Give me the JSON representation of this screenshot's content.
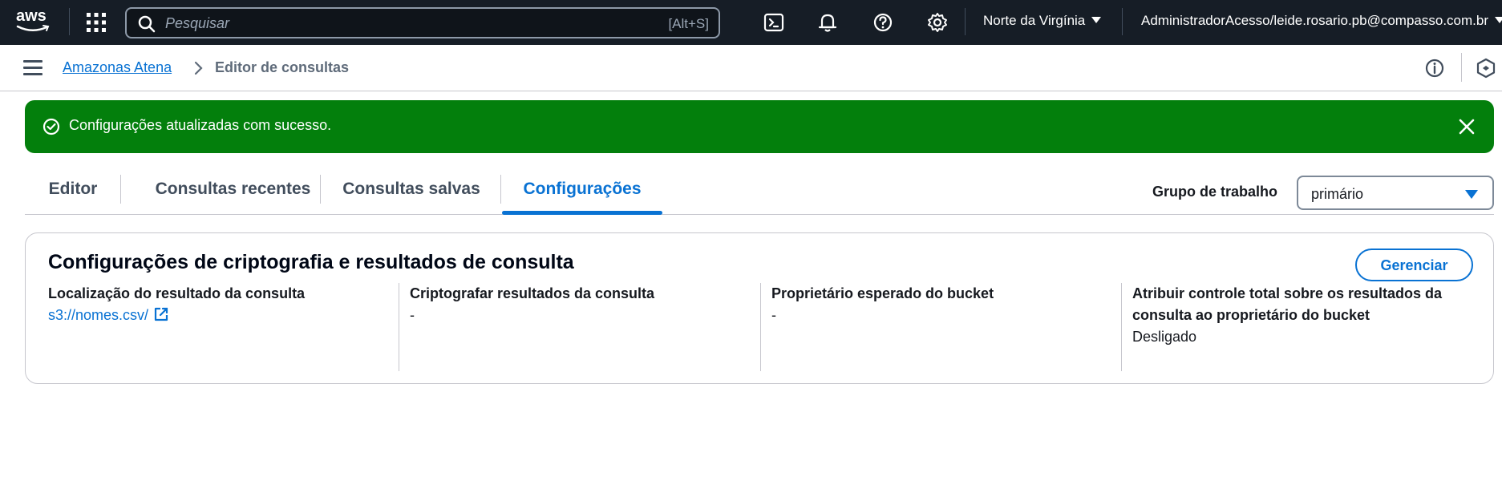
{
  "topnav": {
    "logo_text": "aws",
    "search_placeholder": "Pesquisar",
    "search_shortcut": "[Alt+S]",
    "region": "Norte da Virgínia",
    "account": "AdministradorAcesso/leide.rosario.pb@compasso.com.br",
    "icons": [
      "apps-grid-icon",
      "cloudshell-icon",
      "bell-icon",
      "help-icon",
      "gear-icon"
    ]
  },
  "breadcrumb": {
    "items": [
      "Amazonas Atena",
      "Editor de consultas"
    ]
  },
  "flash": {
    "message": "Configurações atualizadas com sucesso.",
    "color": "#037f0c"
  },
  "tabs": {
    "items": [
      "Editor",
      "Consultas recentes",
      "Consultas salvas",
      "Configurações"
    ],
    "active": "Configurações"
  },
  "workgroup": {
    "label": "Grupo de trabalho",
    "value": "primário"
  },
  "settings": {
    "title": "Configurações de criptografia e resultados de consulta",
    "manage_label": "Gerenciar",
    "fields": [
      {
        "key": "Localização do resultado da consulta",
        "value": "s3://nomes.csv/"
      },
      {
        "key": "Criptografar resultados da consulta",
        "value": "-"
      },
      {
        "key": "Proprietário esperado do bucket",
        "value": "-"
      },
      {
        "key": "Atribuir controle total sobre os resultados da consulta ao proprietário do bucket",
        "value": "Desligado"
      }
    ]
  },
  "colors": {
    "accent": "#0972d3",
    "nav_bg": "#161d26",
    "success": "#037f0c"
  }
}
